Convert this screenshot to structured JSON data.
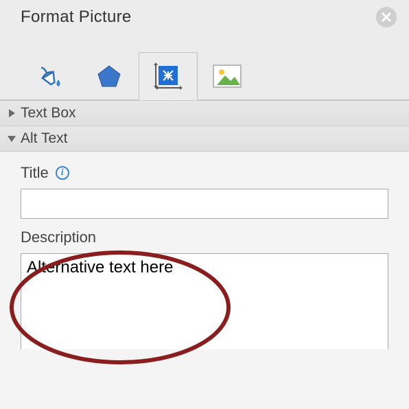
{
  "header": {
    "title": "Format Picture"
  },
  "tabs": {
    "items": [
      {
        "name": "fill-line-tab",
        "icon": "paint-bucket-icon",
        "active": false
      },
      {
        "name": "effects-tab",
        "icon": "pentagon-icon",
        "active": false
      },
      {
        "name": "size-properties-tab",
        "icon": "size-arrows-icon",
        "active": true
      },
      {
        "name": "picture-tab",
        "icon": "picture-icon",
        "active": false
      }
    ]
  },
  "sections": {
    "text_box": {
      "label": "Text Box",
      "expanded": false
    },
    "alt_text": {
      "label": "Alt Text",
      "expanded": true
    }
  },
  "alt_text": {
    "title_label": "Title",
    "title_value": "",
    "description_label": "Description",
    "description_value": "Alternative text here"
  }
}
